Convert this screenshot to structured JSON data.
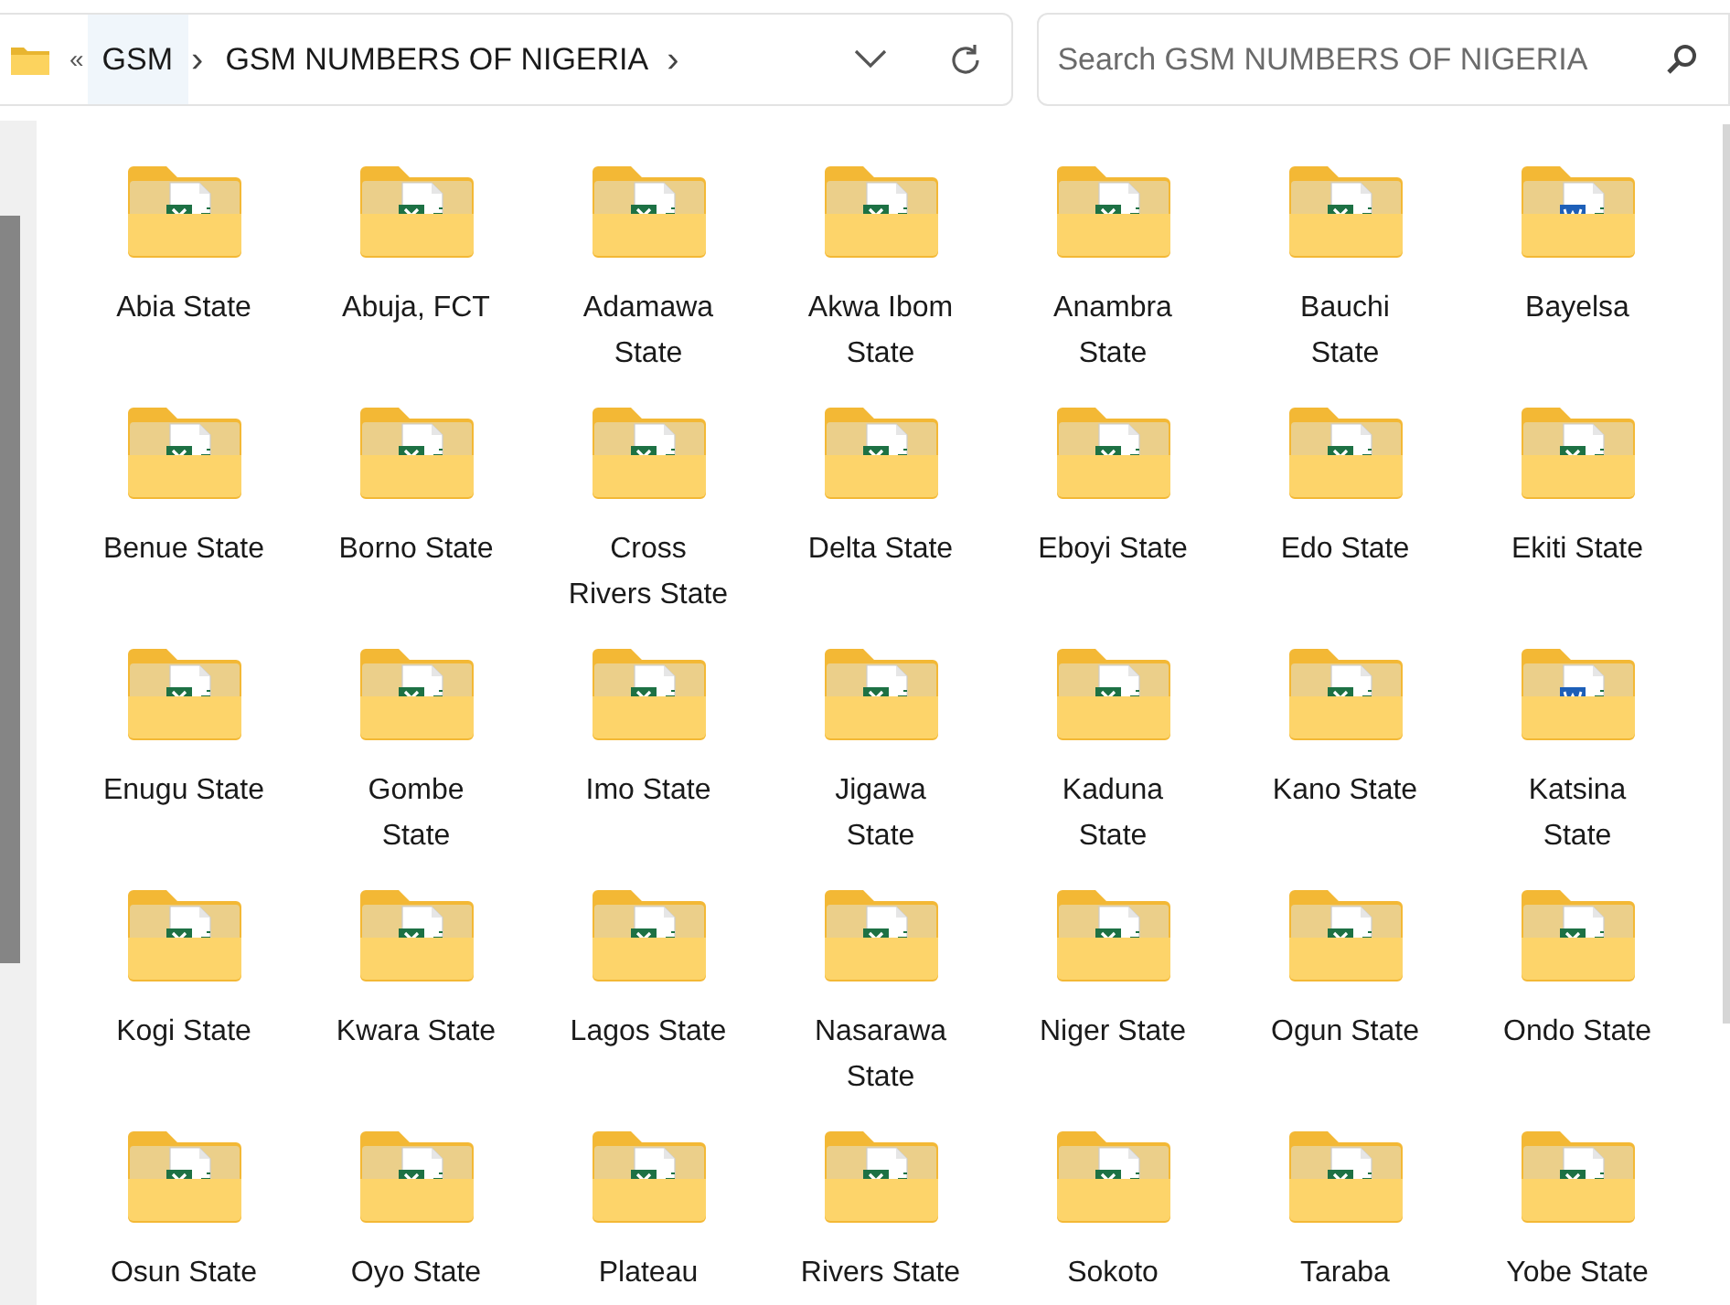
{
  "address_bar": {
    "overflow": "«",
    "crumbs": [
      {
        "label": "GSM",
        "separator": "›",
        "hovered": true
      },
      {
        "label": "GSM NUMBERS OF NIGERIA",
        "separator": "›",
        "hovered": false
      }
    ]
  },
  "search": {
    "placeholder": "Search GSM NUMBERS OF NIGERIA"
  },
  "items": [
    {
      "label": "Abia State",
      "kind": "excel"
    },
    {
      "label": "Abuja, FCT",
      "kind": "excel"
    },
    {
      "label": "Adamawa State",
      "kind": "excel"
    },
    {
      "label": "Akwa Ibom State",
      "kind": "excel"
    },
    {
      "label": "Anambra State",
      "kind": "excel"
    },
    {
      "label": "Bauchi State",
      "kind": "excel"
    },
    {
      "label": "Bayelsa",
      "kind": "word"
    },
    {
      "label": "Benue State",
      "kind": "excel"
    },
    {
      "label": "Borno State",
      "kind": "excel"
    },
    {
      "label": "Cross Rivers State",
      "kind": "excel"
    },
    {
      "label": "Delta State",
      "kind": "excel"
    },
    {
      "label": "Eboyi State",
      "kind": "excel"
    },
    {
      "label": "Edo State",
      "kind": "excel"
    },
    {
      "label": "Ekiti State",
      "kind": "excel"
    },
    {
      "label": "Enugu State",
      "kind": "excel"
    },
    {
      "label": "Gombe State",
      "kind": "excel"
    },
    {
      "label": "Imo State",
      "kind": "excel"
    },
    {
      "label": "Jigawa State",
      "kind": "excel"
    },
    {
      "label": "Kaduna State",
      "kind": "excel"
    },
    {
      "label": "Kano State",
      "kind": "excel"
    },
    {
      "label": "Katsina State",
      "kind": "word"
    },
    {
      "label": "Kogi State",
      "kind": "excel"
    },
    {
      "label": "Kwara State",
      "kind": "excel"
    },
    {
      "label": "Lagos State",
      "kind": "excel"
    },
    {
      "label": "Nasarawa State",
      "kind": "excel"
    },
    {
      "label": "Niger State",
      "kind": "excel"
    },
    {
      "label": "Ogun State",
      "kind": "excel"
    },
    {
      "label": "Ondo State",
      "kind": "excel"
    },
    {
      "label": "Osun State",
      "kind": "excel"
    },
    {
      "label": "Oyo State",
      "kind": "excel"
    },
    {
      "label": "Plateau",
      "kind": "excel"
    },
    {
      "label": "Rivers State",
      "kind": "excel"
    },
    {
      "label": "Sokoto",
      "kind": "excel"
    },
    {
      "label": "Taraba",
      "kind": "excel"
    },
    {
      "label": "Yobe State",
      "kind": "excel"
    }
  ]
}
